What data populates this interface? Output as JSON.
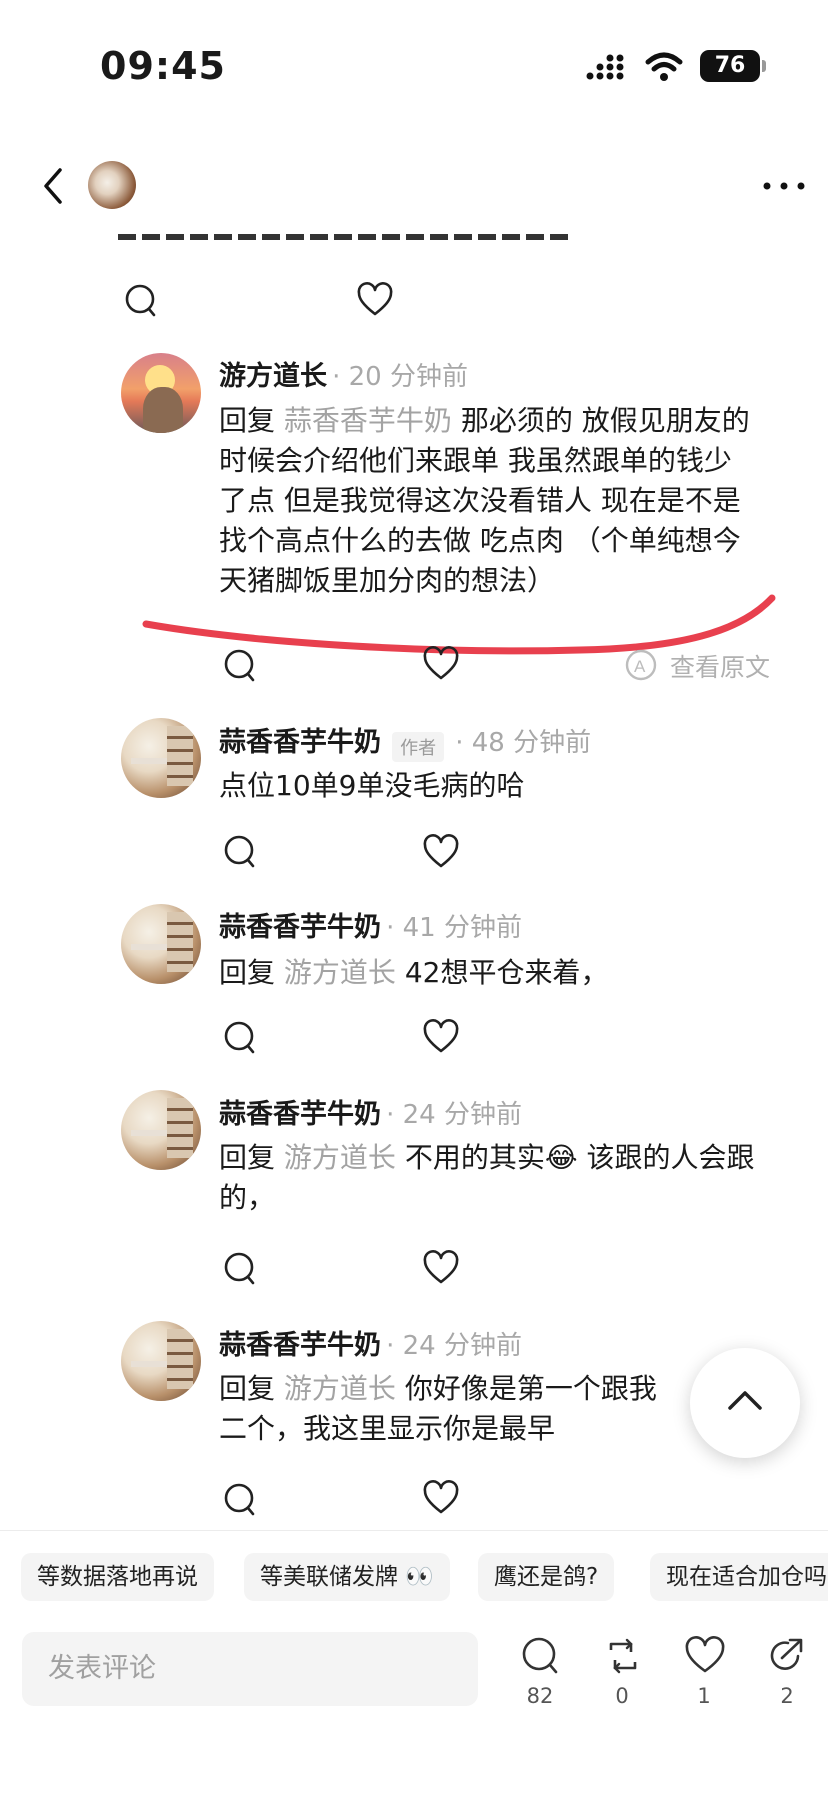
{
  "status_bar": {
    "time": "09:45",
    "battery": "76"
  },
  "comments": [
    {
      "user": "游方道长",
      "time": "· 20 分钟前",
      "reply_prefix": "回复",
      "reply_to": "蒜香香芋牛奶",
      "lines": [
        "那必须的 放假见朋友的",
        "时候会介绍他们来跟单 我虽然跟单的钱少",
        "了点 但是我觉得这次没看错人 现在是不是",
        "找个高点什么的去做 吃点肉 （个单纯想今",
        "天猪脚饭里加分肉的想法）"
      ],
      "translate_label": "查看原文"
    },
    {
      "user": "蒜香香芋牛奶",
      "tag": "作者",
      "time": "· 48 分钟前",
      "text": "点位10单9单没毛病的哈"
    },
    {
      "user": "蒜香香芋牛奶",
      "time": "· 41 分钟前",
      "reply_prefix": "回复",
      "reply_to": "游方道长",
      "text": "42想平仓来着，"
    },
    {
      "user": "蒜香香芋牛奶",
      "time": "· 24 分钟前",
      "reply_prefix": "回复",
      "reply_to": "游方道长",
      "text": "不用的其实😂 该跟的人会跟",
      "text2": "的，"
    },
    {
      "user": "蒜香香芋牛奶",
      "time": "· 24 分钟前",
      "reply_prefix": "回复",
      "reply_to": "游方道长",
      "text": "你好像是第一个跟我",
      "text2": "二个，我这里显示你是最早"
    }
  ],
  "chips": [
    "等数据落地再说",
    "等美联储发牌 👀",
    "鹰还是鸽?",
    "现在适合加仓吗"
  ],
  "bottom_bar": {
    "placeholder": "发表评论",
    "comments": "82",
    "reposts": "0",
    "likes": "1",
    "shares": "2"
  },
  "colors": {
    "annotation": "#e8404e",
    "muted": "#a3a3a3"
  }
}
